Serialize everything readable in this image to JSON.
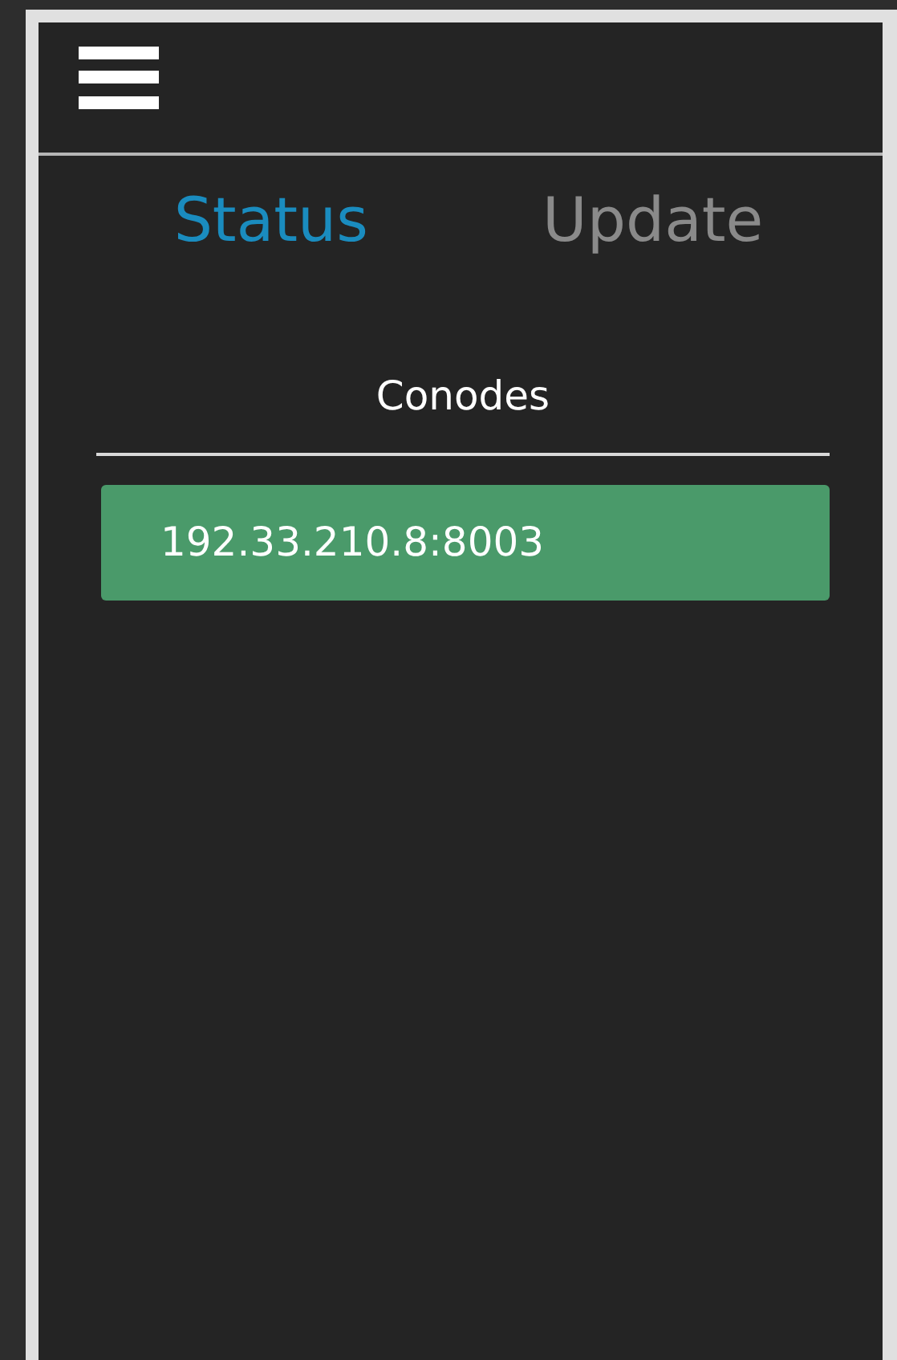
{
  "tabs": [
    {
      "label": "Status",
      "selected": true
    },
    {
      "label": "Update",
      "selected": false
    }
  ],
  "section": {
    "title": "Conodes"
  },
  "conodes": [
    {
      "address": "192.33.210.8:8003"
    }
  ]
}
